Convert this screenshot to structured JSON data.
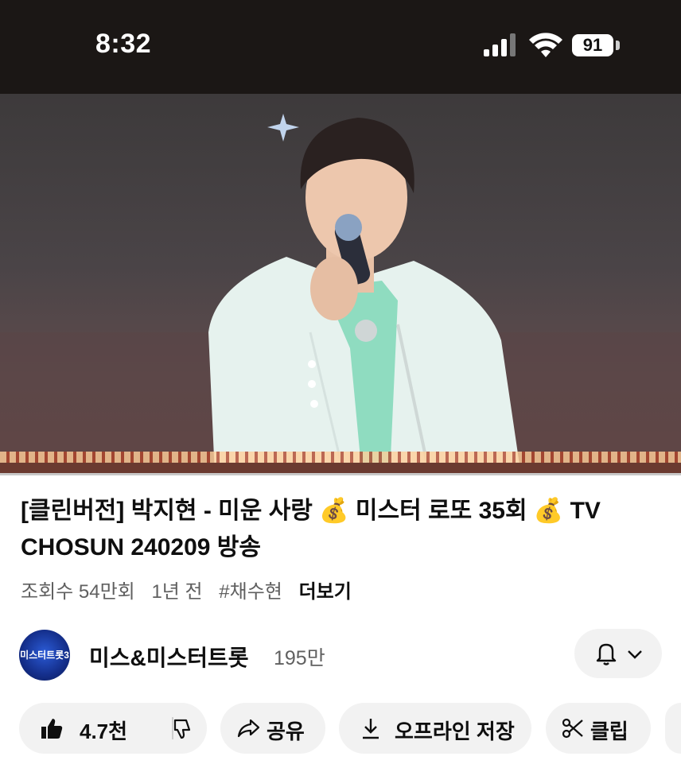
{
  "status_bar": {
    "time": "8:32",
    "battery": "91"
  },
  "video": {
    "title": "[클린버전] 박지현 - 미운 사랑 💰 미스터 로또 35회 💰 TV CHOSUN 240209 방송",
    "views": "조회수 54만회",
    "age": "1년 전",
    "hashtag": "#채수현",
    "more": "더보기"
  },
  "channel": {
    "name": "미스&미스터트롯",
    "subscribers": "195만",
    "avatar_text": "미스터트롯3"
  },
  "actions": {
    "likes": "4.7천",
    "share": "공유",
    "download": "오프라인 저장",
    "clip": "클립"
  },
  "colors": {
    "accent_bg": "#f2f2f2",
    "text": "#0f0f0f",
    "muted": "#606060"
  }
}
